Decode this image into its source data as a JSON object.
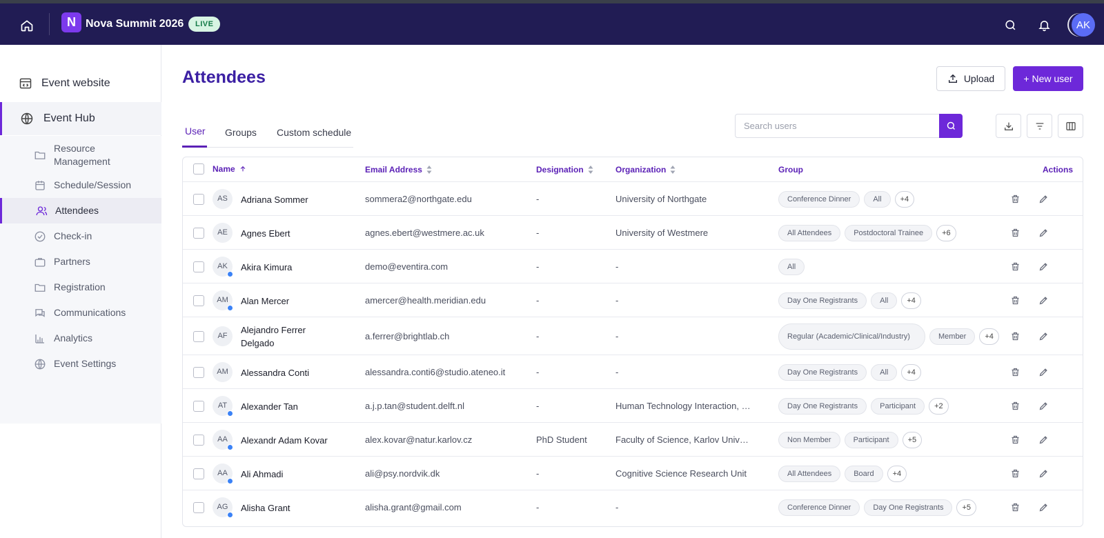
{
  "topbar": {
    "brand_letter": "N",
    "event_name": "Nova Summit 2026",
    "live_badge": "LIVE",
    "user_initials": "AK"
  },
  "sidebar": {
    "top_items": [
      {
        "label": "Event website",
        "icon": "website-icon"
      },
      {
        "label": "Event Hub",
        "icon": "globe-icon",
        "active": true
      }
    ],
    "sub_items": [
      {
        "label": "Resource Management",
        "icon": "folder-icon"
      },
      {
        "label": "Schedule/Session",
        "icon": "calendar-icon"
      },
      {
        "label": "Attendees",
        "icon": "users-icon",
        "active": true
      },
      {
        "label": "Check-in",
        "icon": "check-circle-icon"
      },
      {
        "label": "Partners",
        "icon": "briefcase-icon"
      },
      {
        "label": "Registration",
        "icon": "folder-icon"
      },
      {
        "label": "Communications",
        "icon": "chat-icon"
      },
      {
        "label": "Analytics",
        "icon": "bar-chart-icon"
      },
      {
        "label": "Event Settings",
        "icon": "globe-icon"
      }
    ]
  },
  "main": {
    "title": "Attendees",
    "upload_label": "Upload",
    "new_user_label": "+ New user",
    "tabs": [
      {
        "label": "User",
        "active": true
      },
      {
        "label": "Groups"
      },
      {
        "label": "Custom schedule"
      }
    ],
    "search_placeholder": "Search users"
  },
  "table": {
    "columns": {
      "name": "Name",
      "email": "Email Address",
      "designation": "Designation",
      "organization": "Organization",
      "group": "Group",
      "actions": "Actions"
    },
    "rows": [
      {
        "initials": "AS",
        "online": false,
        "name": "Adriana Sommer",
        "email": "sommera2@northgate.edu",
        "designation": "-",
        "organization": "University of Northgate",
        "groups": [
          "Conference Dinner",
          "All"
        ],
        "more": "+4"
      },
      {
        "initials": "AE",
        "online": false,
        "name": "Agnes Ebert",
        "email": "agnes.ebert@westmere.ac.uk",
        "designation": "-",
        "organization": "University of Westmere",
        "groups": [
          "All Attendees",
          "Postdoctoral Trainee"
        ],
        "more": "+6"
      },
      {
        "initials": "AK",
        "online": true,
        "name": "Akira Kimura",
        "email": "demo@eventira.com",
        "designation": "-",
        "organization": "-",
        "groups": [
          "All"
        ],
        "more": ""
      },
      {
        "initials": "AM",
        "online": true,
        "name": "Alan Mercer",
        "email": "amercer@health.meridian.edu",
        "designation": "-",
        "organization": "-",
        "groups": [
          "Day One Registrants",
          "All"
        ],
        "more": "+4"
      },
      {
        "initials": "AF",
        "online": false,
        "name": "Alejandro Ferrer Delgado",
        "email": "a.ferrer@brightlab.ch",
        "designation": "-",
        "organization": "-",
        "groups": [
          "Regular (Academic/Clinical/Industry)",
          "Member"
        ],
        "more": "+4",
        "tall": true
      },
      {
        "initials": "AM",
        "online": false,
        "name": "Alessandra Conti",
        "email": "alessandra.conti6@studio.ateneo.it",
        "designation": "-",
        "organization": "-",
        "groups": [
          "Day One Registrants",
          "All"
        ],
        "more": "+4"
      },
      {
        "initials": "AT",
        "online": true,
        "name": "Alexander Tan",
        "email": "a.j.p.tan@student.delft.nl",
        "designation": "-",
        "organization": "Human Technology Interaction, Eindhoven",
        "groups": [
          "Day One Registrants",
          "Participant"
        ],
        "more": "+2"
      },
      {
        "initials": "AA",
        "online": true,
        "name": "Alexandr Adam Kovar",
        "email": "alex.kovar@natur.karlov.cz",
        "designation": "PhD Student",
        "organization": "Faculty of Science, Karlov University",
        "groups": [
          "Non Member",
          "Participant"
        ],
        "more": "+5"
      },
      {
        "initials": "AA",
        "online": true,
        "name": "Ali Ahmadi",
        "email": "ali@psy.nordvik.dk",
        "designation": "-",
        "organization": "Cognitive Science Research Unit",
        "groups": [
          "All Attendees",
          "Board"
        ],
        "more": "+4"
      },
      {
        "initials": "AG",
        "online": true,
        "name": "Alisha Grant",
        "email": "alisha.grant@gmail.com",
        "designation": "-",
        "organization": "-",
        "groups": [
          "Conference Dinner",
          "Day One Registrants"
        ],
        "more": "+5"
      }
    ]
  }
}
